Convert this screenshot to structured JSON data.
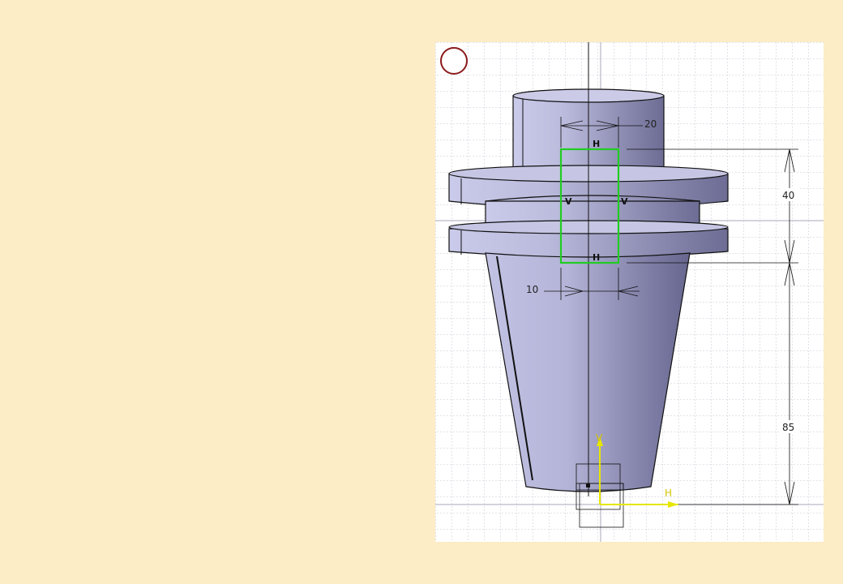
{
  "sketch": {
    "dimensions": {
      "top_width": "20",
      "bottom_width": "10",
      "height_upper": "40",
      "height_lower": "85"
    },
    "constraint_labels": {
      "top_horizontal": "H",
      "bottom_horizontal": "H",
      "left_vertical": "V",
      "right_vertical": "V"
    },
    "axis_labels": {
      "horizontal": "H",
      "vertical": "V"
    }
  },
  "colors": {
    "background": "#fcedc6",
    "viewport": "#ffffff",
    "grid": "#b8b8c8",
    "part_fill": "#b4b4d8",
    "sketch_profile": "#22cc22",
    "axis": "#e6e600",
    "indicator_ring": "#8b1a1a"
  }
}
